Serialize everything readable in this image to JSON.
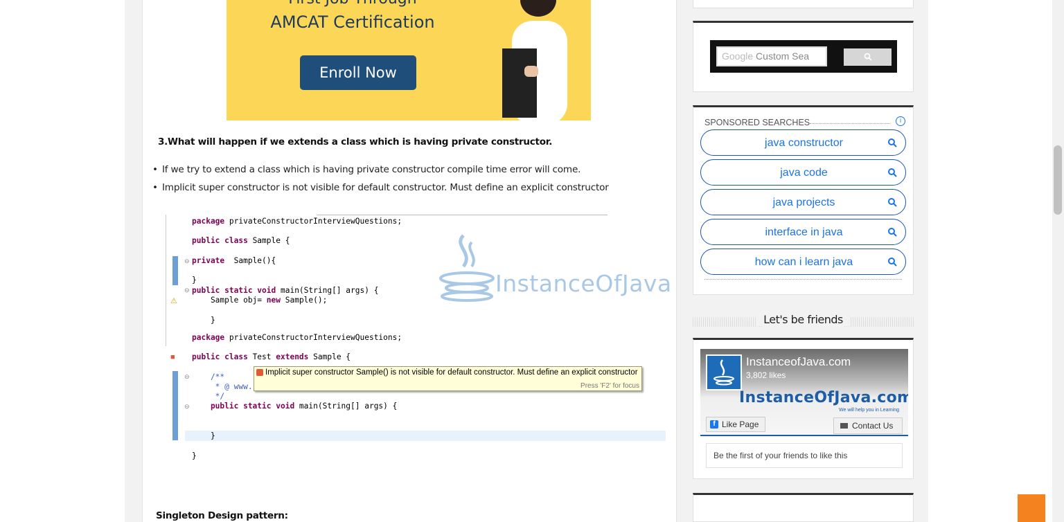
{
  "banner": {
    "top_text": "First Job Through",
    "title": "AMCAT Certification",
    "button": "Enroll Now"
  },
  "article": {
    "question": "3.What will happen if we extends a class which is having private constructor.",
    "bullets": [
      "If we try to extend a class which is having private constructor compile time error will come.",
      "Implicit super constructor is not visible for default constructor. Must define an explicit constructor"
    ],
    "code": {
      "l1": "package privateConstructorInterviewQuestions;",
      "l2_kw": "public class",
      "l2_rest": " Sample {",
      "l3_kw": "private",
      "l3_rest": "  Sample(){",
      "l4": "}",
      "l5_kw": "public static void",
      "l5_rest": " main(String[] args) {",
      "l6_a": "    Sample obj= ",
      "l6_kw": "new",
      "l6_b": " Sample();",
      "l7": "    }",
      "l8": "package privateConstructorInterviewQuestions;",
      "l9_kw": "public class",
      "l9_rest": " Test ",
      "l9_kw2": "extends",
      "l9_rest2": " Sample {",
      "l10": "    /**",
      "l11": "     * @ www.",
      "l12": "     */",
      "l13_kw": "    public static void",
      "l13_rest": " main(String[] args) {",
      "l14": "    }",
      "l15": "}"
    },
    "watermark": "InstanceOfJava",
    "tooltip_message": "Implicit super constructor Sample() is not visible for default constructor. Must define an explicit constructor",
    "tooltip_hint": "Press 'F2' for focus",
    "next_heading": "Singleton Design pattern:"
  },
  "sidebar": {
    "search": {
      "placeholder_brand": "Google",
      "placeholder": "Custom Sea"
    },
    "sponsored": {
      "title": "SPONSORED SEARCHES",
      "info_icon": "info-icon",
      "items": [
        {
          "label": "java constructor"
        },
        {
          "label": "java code"
        },
        {
          "label": "java projects"
        },
        {
          "label": "interface in java"
        },
        {
          "label": "how can i learn java"
        }
      ]
    },
    "friends": {
      "heading": "Let's be friends",
      "page_name": "InstanceofJava.com",
      "likes": "3,802 likes",
      "brand": "InstanceOfJava.com",
      "tagline": "We will help you in Learning",
      "like_button": "Like Page",
      "contact_button": "Contact Us",
      "friends_text": "Be the first of your friends to like this"
    }
  },
  "colors": {
    "accent_blue": "#1a73e8",
    "banner_yellow": "#fcd757",
    "orange": "#f4831f"
  }
}
